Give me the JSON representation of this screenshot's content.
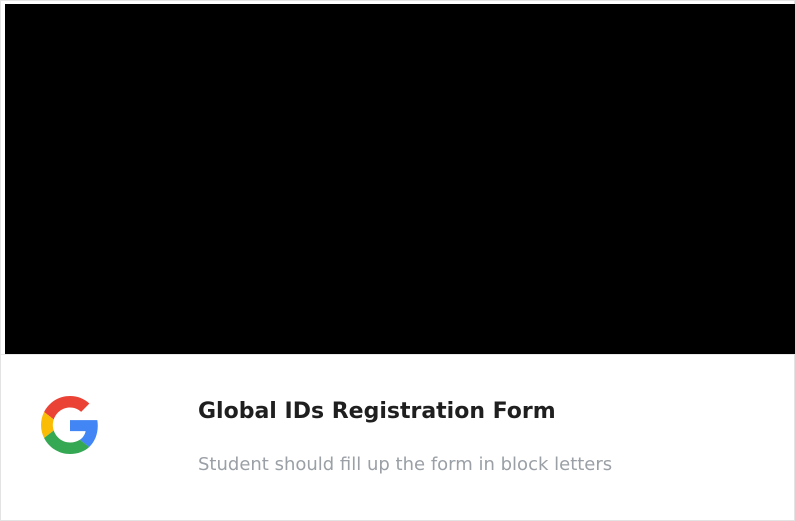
{
  "link_card": {
    "preview_image": "black-preview",
    "logo_icon": "google-g-icon",
    "title": "Global IDs Registration Form",
    "description": "Student should fill up the form in block letters",
    "colors": {
      "title": "#1f1f1f",
      "description": "#9aa0a6",
      "preview_background": "#000000",
      "google_blue": "#4285F4",
      "google_red": "#EA4335",
      "google_yellow": "#FBBC05",
      "google_green": "#34A853"
    }
  }
}
